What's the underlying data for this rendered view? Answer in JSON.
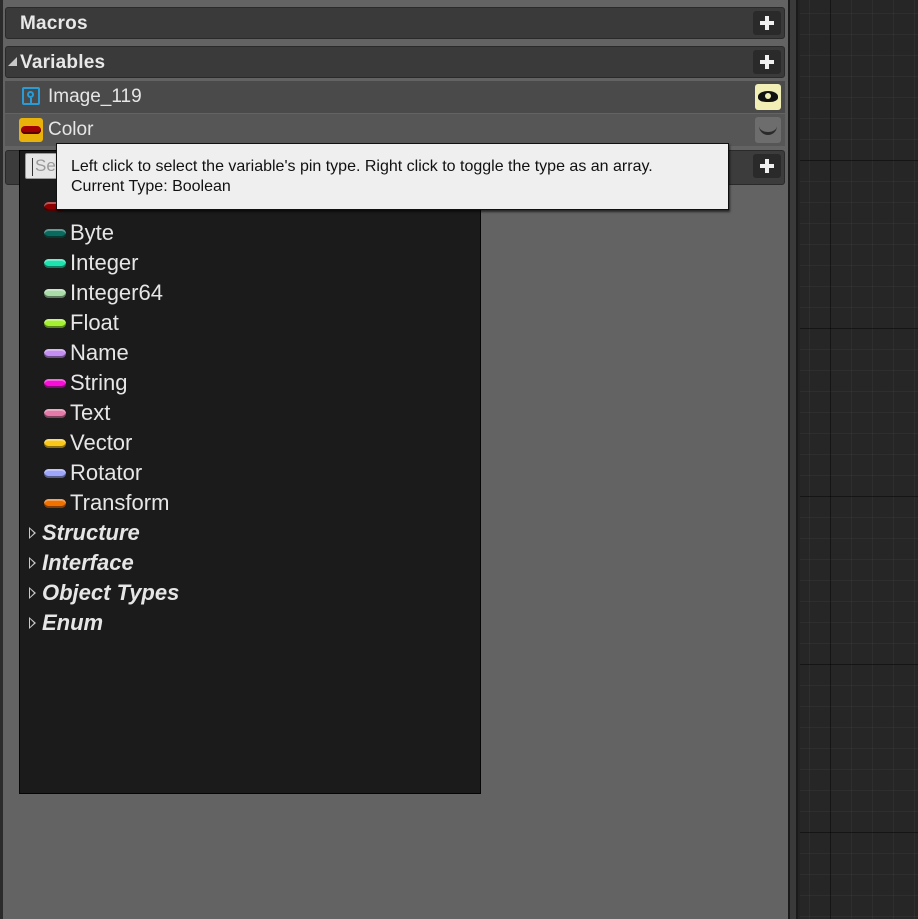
{
  "sections": {
    "macros": {
      "title": "Macros"
    },
    "variables": {
      "title": "Variables"
    }
  },
  "variables": [
    {
      "name": "Image_119",
      "icon": "image-variable-icon",
      "visibility": "visible-eye-icon"
    },
    {
      "name": "Color",
      "icon": "color-pin-icon",
      "visibility": "hidden-eye-icon"
    }
  ],
  "tooltip": {
    "line1": "Left click to select the variable's pin type. Right click to toggle the type as an array.",
    "line2": "Current Type: Boolean"
  },
  "type_picker": {
    "search_placeholder": "Se",
    "types": [
      {
        "label": "Byte",
        "color": "#0a6a5e"
      },
      {
        "label": "Integer",
        "color": "#1fe3af"
      },
      {
        "label": "Integer64",
        "color": "#a9dca8"
      },
      {
        "label": "Float",
        "color": "#a3f130"
      },
      {
        "label": "Name",
        "color": "#c58ef2"
      },
      {
        "label": "String",
        "color": "#f80ed8"
      },
      {
        "label": "Text",
        "color": "#e37aa8"
      },
      {
        "label": "Vector",
        "color": "#fbc81a"
      },
      {
        "label": "Rotator",
        "color": "#9da6fb"
      },
      {
        "label": "Transform",
        "color": "#f07000"
      }
    ],
    "categories": [
      {
        "label": "Structure"
      },
      {
        "label": "Interface"
      },
      {
        "label": "Object Types"
      },
      {
        "label": "Enum"
      }
    ],
    "boolean_pin_color": "#8c0000"
  },
  "colors": {
    "panel_bg": "#636363",
    "header_bg": "#3a3a3a",
    "list_bg": "#1b1b1b",
    "tooltip_bg": "#efefef",
    "image_icon_blue": "#2b9bd6",
    "color_icon_gold": "#e8b20a"
  }
}
